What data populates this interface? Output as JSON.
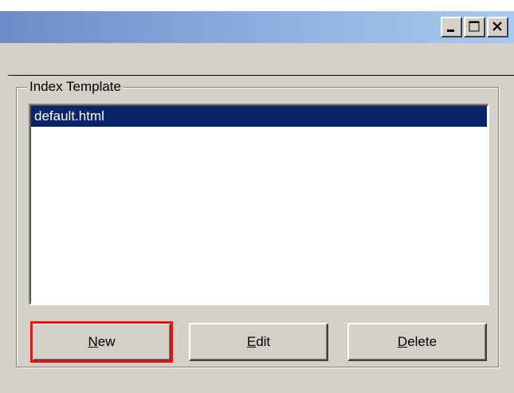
{
  "window": {
    "title": "",
    "controls": {
      "minimize_icon": "minimize-icon",
      "maximize_icon": "maximize-icon",
      "close_icon": "close-icon"
    }
  },
  "group": {
    "label": "Index Template"
  },
  "list": {
    "items": [
      {
        "label": "default.html",
        "selected": true
      }
    ]
  },
  "buttons": {
    "new": {
      "mnemonic": "N",
      "rest": "ew"
    },
    "edit": {
      "mnemonic": "E",
      "rest": "dit"
    },
    "delete": {
      "mnemonic": "D",
      "rest": "elete"
    }
  },
  "colors": {
    "face": "#d4d0c8",
    "selection": "#0a246a",
    "highlight_outline": "#e81010",
    "title_gradient_start": "#6b8cc6",
    "title_gradient_end": "#a6caf0"
  }
}
